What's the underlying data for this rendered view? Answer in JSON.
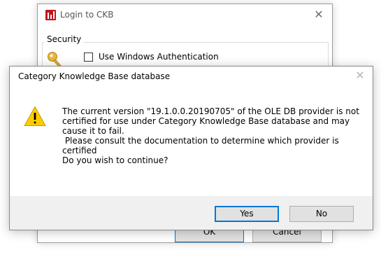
{
  "login_window": {
    "title": "Login to CKB",
    "close_glyph": "✕",
    "security_legend": "Security",
    "windows_auth_label": "Use Windows Authentication",
    "windows_auth_checked": false,
    "ok_label": "OK",
    "cancel_label": "Cancel",
    "icons": {
      "app": "ckb-app-icon",
      "key": "key-icon"
    }
  },
  "message_box": {
    "title": "Category Knowledge Base database",
    "close_glyph": "✕",
    "icon": "warning-icon",
    "message_lines": [
      "The current version \"19.1.0.0.20190705\" of the OLE DB provider is not",
      "certified for use under Category Knowledge Base database and may",
      "cause it to fail.",
      " Please consult the documentation to determine which provider is",
      "certified",
      "Do you wish to continue?"
    ],
    "yes_label": "Yes",
    "no_label": "No",
    "default_button": "Yes"
  },
  "colors": {
    "accent": "#0078d7",
    "app_icon": "#c0161c",
    "warning_fill": "#ffcc00",
    "footer_bg": "#f0f0f0",
    "button_bg": "#e1e1e1"
  }
}
